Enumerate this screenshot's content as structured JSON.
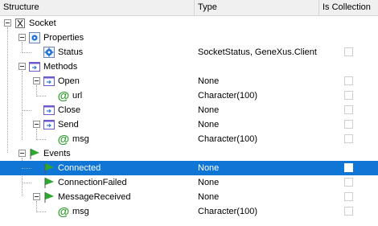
{
  "header": {
    "structure": "Structure",
    "type": "Type",
    "is_collection": "Is Collection"
  },
  "rows": [
    {
      "label": "Socket",
      "type": "",
      "icon": "external-object-icon",
      "has_checkbox": false
    },
    {
      "label": "Properties",
      "type": "",
      "icon": "properties-icon",
      "has_checkbox": false
    },
    {
      "label": "Status",
      "type": "SocketStatus, GeneXus.Client",
      "icon": "property-gear-icon",
      "has_checkbox": true
    },
    {
      "label": "Methods",
      "type": "",
      "icon": "methods-icon",
      "has_checkbox": false
    },
    {
      "label": "Open",
      "type": "None",
      "icon": "method-icon",
      "has_checkbox": true
    },
    {
      "label": "url",
      "type": "Character(100)",
      "icon": "parameter-at-icon",
      "has_checkbox": true
    },
    {
      "label": "Close",
      "type": "None",
      "icon": "method-icon",
      "has_checkbox": true
    },
    {
      "label": "Send",
      "type": "None",
      "icon": "method-icon",
      "has_checkbox": true
    },
    {
      "label": "msg",
      "type": "Character(100)",
      "icon": "parameter-at-icon",
      "has_checkbox": true
    },
    {
      "label": "Events",
      "type": "",
      "icon": "events-flag-icon",
      "has_checkbox": false
    },
    {
      "label": "Connected",
      "type": "None",
      "icon": "event-flag-icon",
      "has_checkbox": true,
      "selected": true
    },
    {
      "label": "ConnectionFailed",
      "type": "None",
      "icon": "event-flag-icon",
      "has_checkbox": true
    },
    {
      "label": "MessageReceived",
      "type": "None",
      "icon": "event-flag-icon",
      "has_checkbox": true
    },
    {
      "label": "msg",
      "type": "Character(100)",
      "icon": "parameter-at-icon",
      "has_checkbox": true
    }
  ],
  "colors": {
    "selection": "#0f76d6",
    "event_flag": "#2fa82f",
    "parameter_at": "#2a9d2a",
    "method_border": "#6a5acd",
    "property_blue": "#1e6fd0"
  }
}
